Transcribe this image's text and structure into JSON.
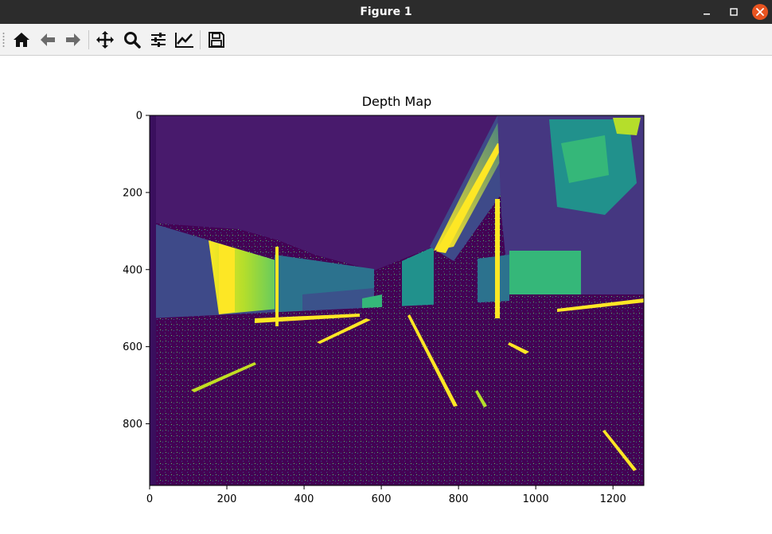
{
  "window": {
    "title": "Figure 1"
  },
  "toolbar": {
    "buttons": [
      {
        "name": "home-icon",
        "tip": "Reset original view"
      },
      {
        "name": "back-icon",
        "tip": "Back to previous view"
      },
      {
        "name": "forward-icon",
        "tip": "Forward to next view"
      },
      {
        "name": "pan-icon",
        "tip": "Pan axes"
      },
      {
        "name": "zoom-icon",
        "tip": "Zoom to rectangle"
      },
      {
        "name": "subplots-icon",
        "tip": "Configure subplots"
      },
      {
        "name": "customize-icon",
        "tip": "Edit axis, curve and image parameters"
      },
      {
        "name": "save-icon",
        "tip": "Save the figure"
      }
    ]
  },
  "colors": {
    "titlebar": "#2c2c2c",
    "close": "#e95420",
    "viridis_low": "#440154",
    "viridis_mid": "#21918c",
    "viridis_high": "#fde725"
  },
  "chart_data": {
    "type": "heatmap",
    "title": "Depth Map",
    "colormap": "viridis",
    "image_width": 1280,
    "image_height": 960,
    "xlim": [
      0,
      1280
    ],
    "ylim": [
      960,
      0
    ],
    "x_ticks": [
      0,
      200,
      400,
      600,
      800,
      1000,
      1200
    ],
    "y_ticks": [
      0,
      200,
      400,
      600,
      800
    ]
  }
}
